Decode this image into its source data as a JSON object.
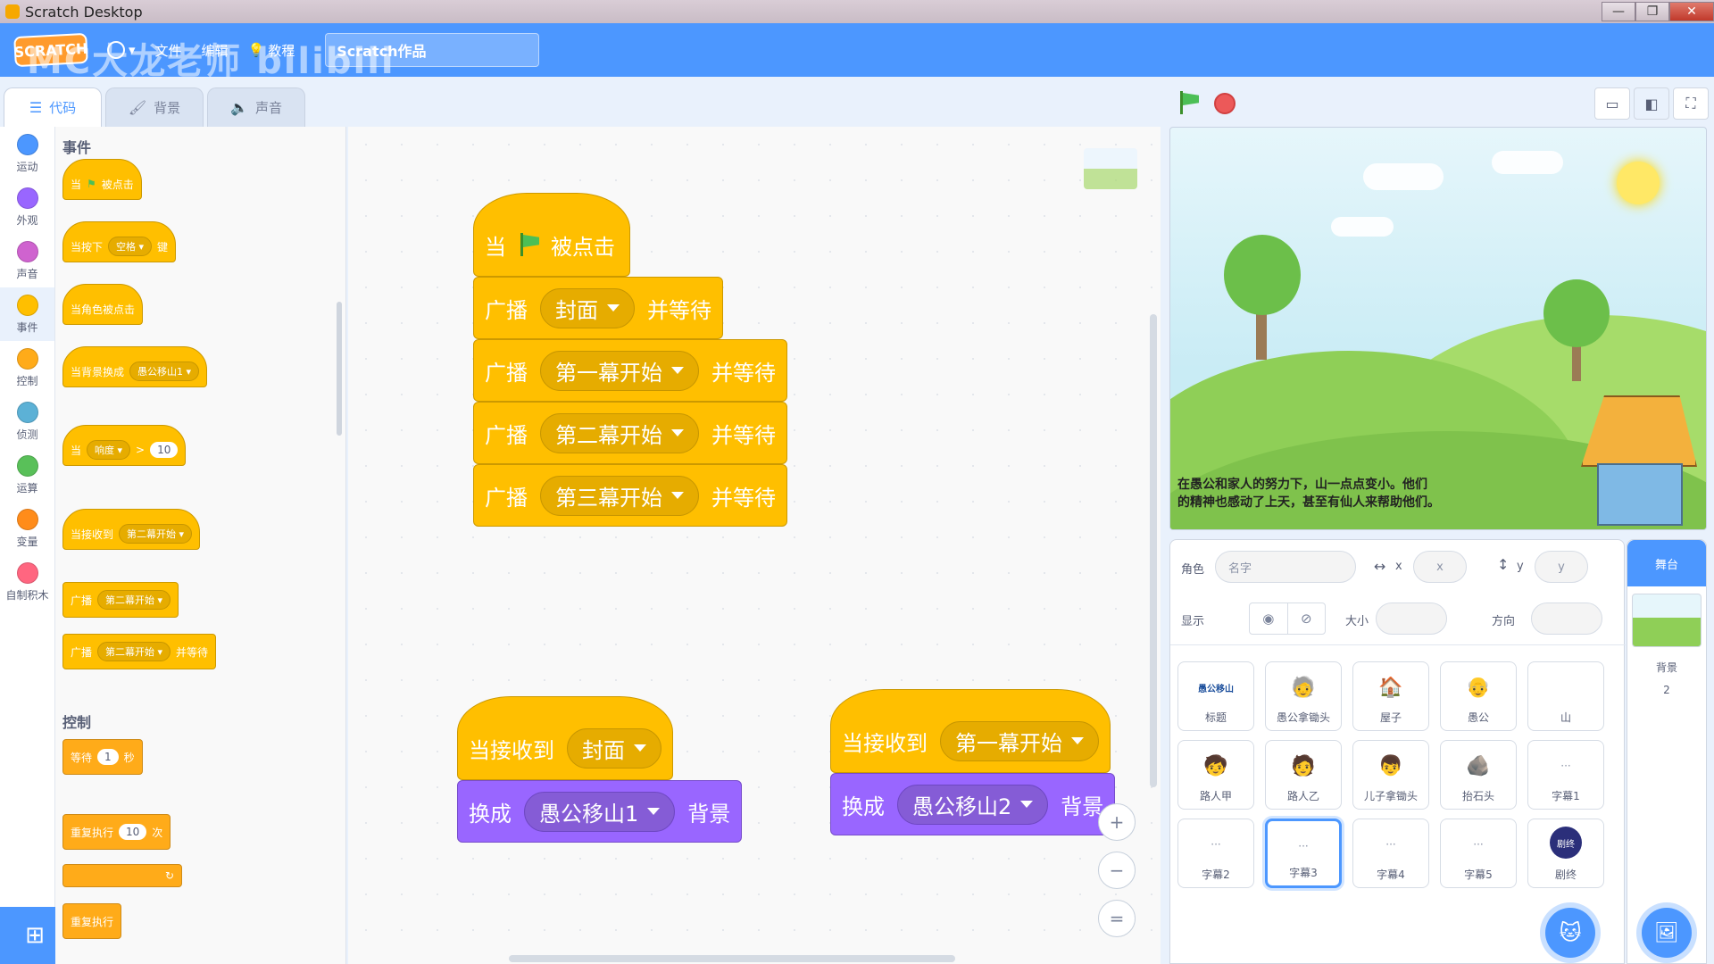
{
  "window": {
    "title": "Scratch Desktop",
    "minimize": "—",
    "maximize": "❐",
    "close": "✕"
  },
  "menubar": {
    "logo": "SCRATCH",
    "watermark": "MC大龙老师 bilibili",
    "items": [
      "文件",
      "编辑",
      "教程"
    ],
    "project_title": "Scratch作品"
  },
  "tabs": [
    {
      "label": "代码",
      "icon": "code-icon"
    },
    {
      "label": "背景",
      "icon": "brush-icon"
    },
    {
      "label": "声音",
      "icon": "speaker-icon"
    }
  ],
  "categories": [
    {
      "label": "运动",
      "color": "#4c97ff"
    },
    {
      "label": "外观",
      "color": "#9966ff"
    },
    {
      "label": "声音",
      "color": "#cf63cf"
    },
    {
      "label": "事件",
      "color": "#ffbf00"
    },
    {
      "label": "控制",
      "color": "#ffab19"
    },
    {
      "label": "侦测",
      "color": "#5cb1d6"
    },
    {
      "label": "运算",
      "color": "#59c059"
    },
    {
      "label": "变量",
      "color": "#ff8c1a"
    },
    {
      "label": "自制积木",
      "color": "#ff6680"
    }
  ],
  "palette": {
    "events_title": "事件",
    "control_title": "控制",
    "b1": {
      "when": "当",
      "clicked": "被点击"
    },
    "b2": {
      "prefix": "当按下",
      "key": "空格",
      "suffix": "键"
    },
    "b3": {
      "text": "当角色被点击"
    },
    "b4": {
      "prefix": "当背景换成",
      "value": "愚公移山1"
    },
    "b5": {
      "prefix": "当",
      "option": "响度",
      "op": ">",
      "value": "10"
    },
    "b6": {
      "prefix": "当接收到",
      "value": "第二幕开始"
    },
    "b7": {
      "prefix": "广播",
      "value": "第二幕开始"
    },
    "b8": {
      "prefix": "广播",
      "value": "第二幕开始",
      "suffix": "并等待"
    },
    "c1": {
      "prefix": "等待",
      "value": "1",
      "suffix": "秒"
    },
    "c2": {
      "prefix": "重复执行",
      "value": "10",
      "suffix": "次"
    },
    "c3": {
      "text": "重复执行"
    }
  },
  "script": {
    "hat_when": "当",
    "hat_clicked": "被点击",
    "broadcast": "广播",
    "and_wait": "并等待",
    "bc1": "封面",
    "bc2": "第一幕开始",
    "bc3": "第二幕开始",
    "bc4": "第三幕开始",
    "recv_label": "当接收到",
    "recv1": "封面",
    "switch_label": "换成",
    "backdrop_label": "背景",
    "switch1": "愚公移山1",
    "recv2": "第一幕开始",
    "switch2": "愚公移山2",
    "zoom_in": "+",
    "zoom_out": "−",
    "zoom_reset": "="
  },
  "stage": {
    "caption_line1": "在愚公和家人的努力下，山一点点变小。他们",
    "caption_line2": "的精神也感动了上天，甚至有仙人来帮助他们。"
  },
  "sprite_info": {
    "sprite_label": "角色",
    "name_placeholder": "名字",
    "x_label": "x",
    "x_placeholder": "x",
    "y_label": "y",
    "y_placeholder": "y",
    "show_label": "显示",
    "size_label": "大小",
    "direction_label": "方向"
  },
  "sprites": [
    {
      "name": "标题",
      "thumb": "愚公移山"
    },
    {
      "name": "愚公拿锄头",
      "thumb": "🧓"
    },
    {
      "name": "屋子",
      "thumb": "🏠"
    },
    {
      "name": "愚公",
      "thumb": "👴"
    },
    {
      "name": "山",
      "thumb": ""
    },
    {
      "name": "路人甲",
      "thumb": "🧒"
    },
    {
      "name": "路人乙",
      "thumb": "🧑"
    },
    {
      "name": "儿子拿锄头",
      "thumb": "👦"
    },
    {
      "name": "抬石头",
      "thumb": "🪨"
    },
    {
      "name": "字幕1",
      "thumb": "···"
    },
    {
      "name": "字幕2",
      "thumb": "···"
    },
    {
      "name": "字幕3",
      "thumb": "···",
      "selected": true
    },
    {
      "name": "字幕4",
      "thumb": "···"
    },
    {
      "name": "字幕5",
      "thumb": "···"
    },
    {
      "name": "剧终",
      "thumb": "剧终"
    }
  ],
  "stage_pane": {
    "header": "舞台",
    "backdrops_label": "背景",
    "backdrops_count": "2"
  }
}
